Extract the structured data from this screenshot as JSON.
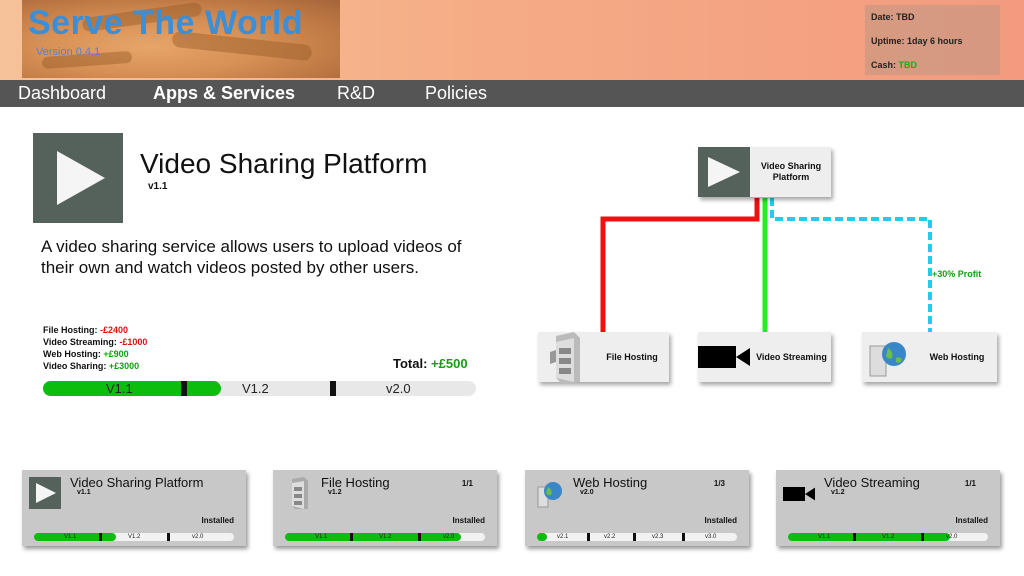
{
  "header": {
    "title": "Serve The World",
    "version": "Version 0.4.1",
    "status": {
      "date_label": "Date:",
      "date_value": "TBD",
      "uptime_label": "Uptime:",
      "uptime_value": "1day 6 hours",
      "cash_label": "Cash:",
      "cash_value": "TBD"
    }
  },
  "nav": {
    "items": [
      {
        "label": "Dashboard",
        "active": false
      },
      {
        "label": "Apps & Services",
        "active": true
      },
      {
        "label": "R&D",
        "active": false
      },
      {
        "label": "Policies",
        "active": false
      }
    ]
  },
  "detail": {
    "icon": "play-icon",
    "title": "Video Sharing Platform",
    "version": "v1.1",
    "description": "A video sharing service allows users to upload videos of their own and watch videos posted by other users.",
    "costs": [
      {
        "label": "File Hosting: ",
        "value": "-£2400",
        "sign": "neg"
      },
      {
        "label": "Video Streaming: ",
        "value": "-£1000",
        "sign": "neg"
      },
      {
        "label": "Web Hosting: ",
        "value": "+£900",
        "sign": "pos"
      },
      {
        "label": "Video Sharing: ",
        "value": "+£3000",
        "sign": "pos"
      }
    ],
    "total_label": "Total: ",
    "total_value": "+£500",
    "progress": {
      "labels": [
        "V1.1",
        "V1.2",
        "v2.0"
      ],
      "fraction": 0.41
    }
  },
  "graph": {
    "root": {
      "label": "Video Sharing Platform",
      "icon": "play-icon"
    },
    "deps": [
      {
        "label": "File Hosting",
        "icon": "server-tower-icon",
        "link_color": "#ee1111"
      },
      {
        "label": "Video Streaming",
        "icon": "video-camera-icon",
        "link_color": "#22ee22"
      },
      {
        "label": "Web Hosting",
        "icon": "globe-server-icon",
        "link_color": "#22ccf0"
      }
    ],
    "profit_label": "+30% Profit"
  },
  "cards": [
    {
      "title": "Video Sharing Platform",
      "version": "v1.1",
      "count": "",
      "status": "Installed",
      "icon": "play-icon",
      "bar_labels": [
        "V1.1",
        "V1.2",
        "v2.0"
      ],
      "fraction": 0.41
    },
    {
      "title": "File Hosting",
      "version": "v1.2",
      "count": "1/1",
      "status": "Installed",
      "icon": "server-tower-icon",
      "bar_labels": [
        "V1.1",
        "V1.2",
        "v2.0"
      ],
      "fraction": 0.88
    },
    {
      "title": "Web Hosting",
      "version": "v2.0",
      "count": "1/3",
      "status": "Installed",
      "icon": "globe-server-icon",
      "bar_labels": [
        "v2.1",
        "v2.2",
        "v2.3",
        "v3.0"
      ],
      "fraction": 0.05
    },
    {
      "title": "Video Streaming",
      "version": "v1.2",
      "count": "1/1",
      "status": "Installed",
      "icon": "video-camera-icon",
      "bar_labels": [
        "V1.1",
        "V1.2",
        "v2.0"
      ],
      "fraction": 0.81
    }
  ]
}
